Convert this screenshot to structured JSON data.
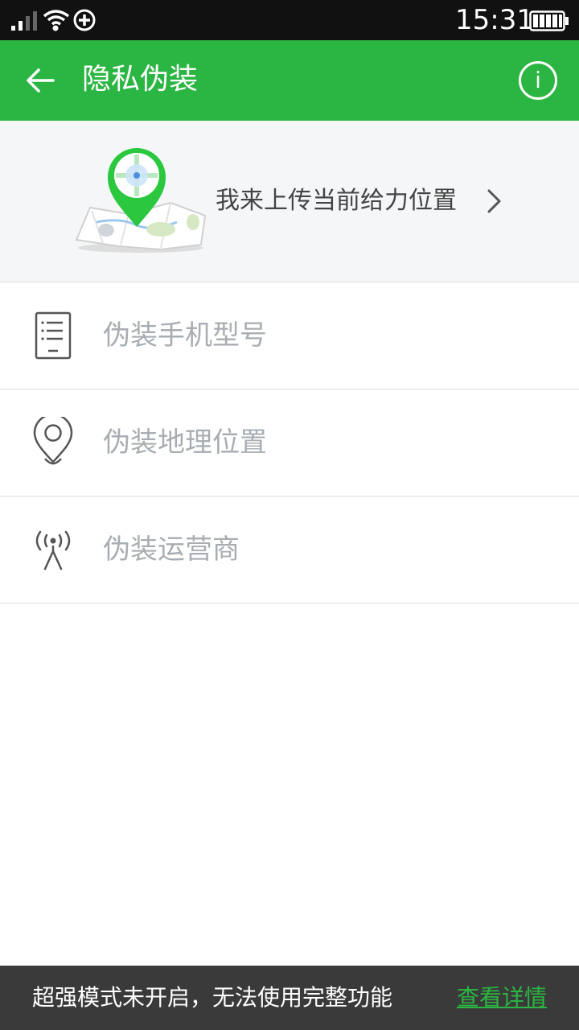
{
  "status_bar": {
    "time": "15:31"
  },
  "app_bar": {
    "title": "隐私伪装",
    "info_glyph": "i",
    "background_color": "#2bb542"
  },
  "banner": {
    "label": "我来上传当前给力位置"
  },
  "items": [
    {
      "label": "伪装手机型号",
      "icon": "phone-model-icon"
    },
    {
      "label": "伪装地理位置",
      "icon": "location-pin-icon"
    },
    {
      "label": "伪装运营商",
      "icon": "signal-tower-icon"
    }
  ],
  "bottom_bar": {
    "message": "超强模式未开启，无法使用完整功能",
    "link": "查看详情"
  }
}
